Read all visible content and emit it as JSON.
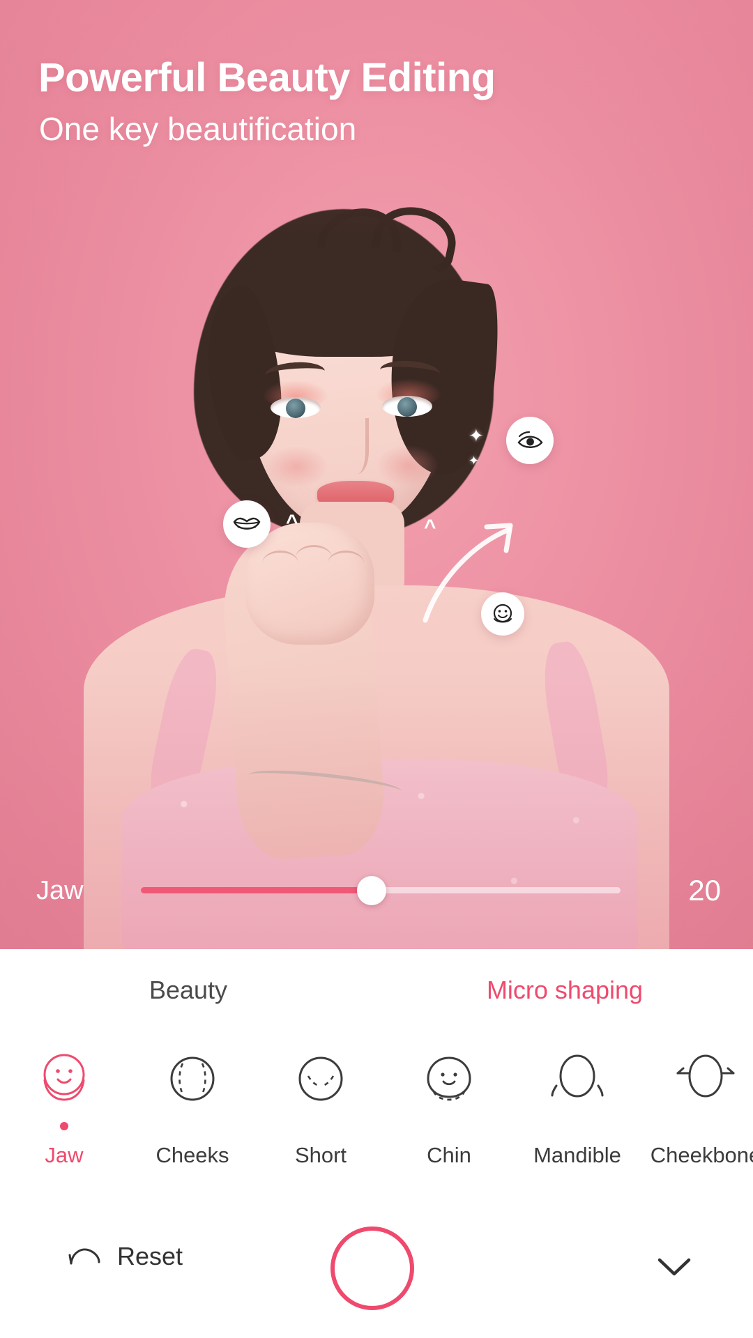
{
  "header": {
    "title": "Powerful Beauty Editing",
    "subtitle": "One key beautification"
  },
  "photo": {
    "badges": [
      {
        "name": "eye-badge",
        "icon": "eye-icon"
      },
      {
        "name": "lips-badge",
        "icon": "lips-icon"
      },
      {
        "name": "face-badge",
        "icon": "smiling-face-icon"
      }
    ],
    "markers": [
      "^",
      "^"
    ]
  },
  "slider": {
    "label": "Jaw",
    "value": "20",
    "min": 0,
    "max": 100,
    "fill_percent": 48
  },
  "tabs": [
    {
      "id": "beauty",
      "label": "Beauty",
      "active": false
    },
    {
      "id": "micro-shaping",
      "label": "Micro shaping",
      "active": true
    }
  ],
  "tools": [
    {
      "id": "jaw",
      "label": "Jaw",
      "icon": "jaw-face-icon",
      "active": true
    },
    {
      "id": "cheeks",
      "label": "Cheeks",
      "icon": "cheeks-face-icon",
      "active": false
    },
    {
      "id": "short",
      "label": "Short",
      "icon": "short-face-icon",
      "active": false
    },
    {
      "id": "chin",
      "label": "Chin",
      "icon": "chin-face-icon",
      "active": false
    },
    {
      "id": "mandible",
      "label": "Mandible",
      "icon": "mandible-face-icon",
      "active": false
    },
    {
      "id": "cheekbone",
      "label": "Cheekbone",
      "icon": "cheekbone-face-icon",
      "active": false
    }
  ],
  "bottom_bar": {
    "reset_label": "Reset",
    "reset_icon": "undo-arc-icon",
    "shutter_name": "capture-button",
    "collapse_icon": "chevron-down-icon"
  },
  "colors": {
    "accent": "#ef4a6e",
    "slider_fill": "#ef5976",
    "background_pink": "#ec8fa2",
    "panel_bg": "#ffffff",
    "text_dark": "#3c3c3c"
  }
}
